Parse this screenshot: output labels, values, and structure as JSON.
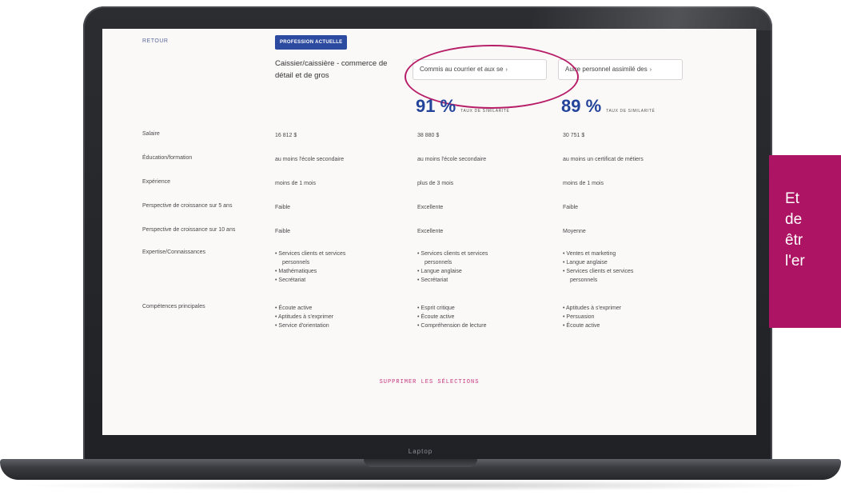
{
  "laptop": {
    "brand": "Laptop"
  },
  "page": {
    "back_link": "RETOUR",
    "current_badge": "PROFESSION ACTUELLE",
    "current_occupation": "Caissier/caissière - commerce de détail et de gros",
    "selects": [
      {
        "label": "Commis au courrier et aux se",
        "chevron": "›"
      },
      {
        "label": "Autre personnel assimilé des",
        "chevron": "›"
      }
    ],
    "rates": [
      {
        "value": "91 %",
        "label": "TAUX DE SIMILARITÉ"
      },
      {
        "value": "89 %",
        "label": "TAUX DE SIMILARITÉ"
      }
    ],
    "rows": [
      {
        "label": "Salaire",
        "cells": [
          "16 812 $",
          "38 880 $",
          "30 751 $"
        ]
      },
      {
        "label": "Éducation/formation",
        "cells": [
          "au moins l'école secondaire",
          "au moins l'école secondaire",
          "au moins un certificat de métiers"
        ]
      },
      {
        "label": "Expérience",
        "cells": [
          "moins de 1 mois",
          "plus de 3 mois",
          "moins de 1 mois"
        ]
      },
      {
        "label": "Perspective de croissance sur 5 ans",
        "cells": [
          "Faible",
          "Excellente",
          "Faible"
        ]
      },
      {
        "label": "Perspective de croissance sur 10 ans",
        "cells": [
          "Faible",
          "Excellente",
          "Moyenne"
        ]
      },
      {
        "label": "Expertise/Connaissances",
        "lists": [
          [
            "Services clients et services",
            "personnels",
            "Mathématiques",
            "Secrétariat"
          ],
          [
            "Services clients et services",
            "personnels",
            "Langue anglaise",
            "Secrétariat"
          ],
          [
            "Ventes et marketing",
            "Langue anglaise",
            "Services clients et services",
            "personnels"
          ]
        ]
      },
      {
        "label": "Compétences principales",
        "lists": [
          [
            "Écoute active",
            "Aptitudes à s'exprimer",
            "Service d'orientation"
          ],
          [
            "Esprit critique",
            "Écoute active",
            "Compréhension de lecture"
          ],
          [
            "Aptitudes à s'exprimer",
            "Persuasion",
            "Écoute active"
          ]
        ]
      }
    ],
    "delete_link": "SUPPRIMER LES SÉLECTIONS"
  },
  "side_panel": {
    "lines": [
      "Et",
      "de",
      "êtr",
      "l'er"
    ],
    "color": "#ad1463"
  }
}
